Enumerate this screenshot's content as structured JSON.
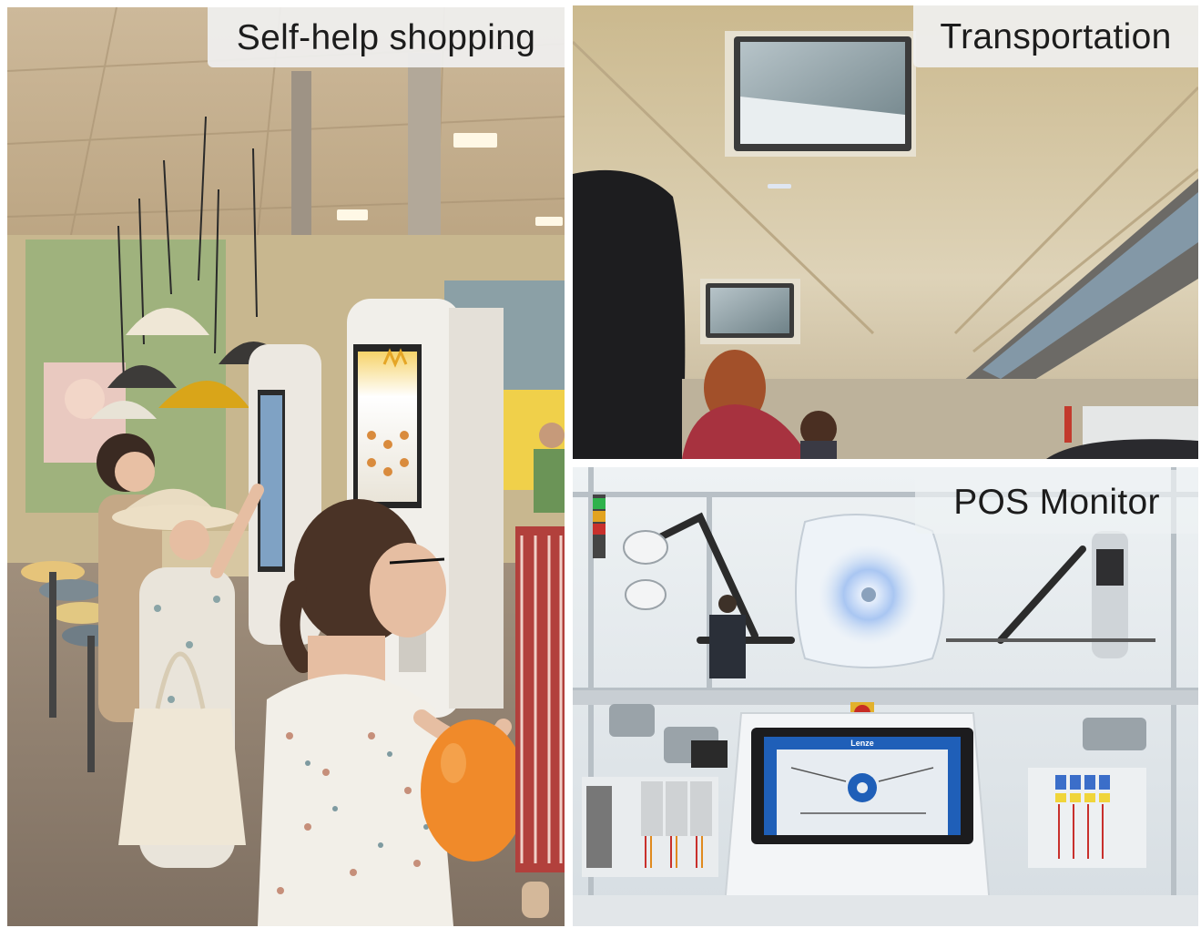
{
  "panels": {
    "self_help": {
      "caption": "Self-help shopping"
    },
    "transportation": {
      "caption": "Transportation"
    },
    "pos_monitor": {
      "caption": "POS Monitor",
      "screen_logo": "Lenze"
    }
  },
  "colors": {
    "restaurant_ceiling": "#d8c7a6",
    "kiosk_white": "#f1efea",
    "balloon_orange": "#f08a2a",
    "lamp_yellow": "#d9a519",
    "train_interior": "#d4c8ad",
    "monitor_bezel": "#3b3b3b",
    "pos_blue": "#1f5fb8"
  }
}
